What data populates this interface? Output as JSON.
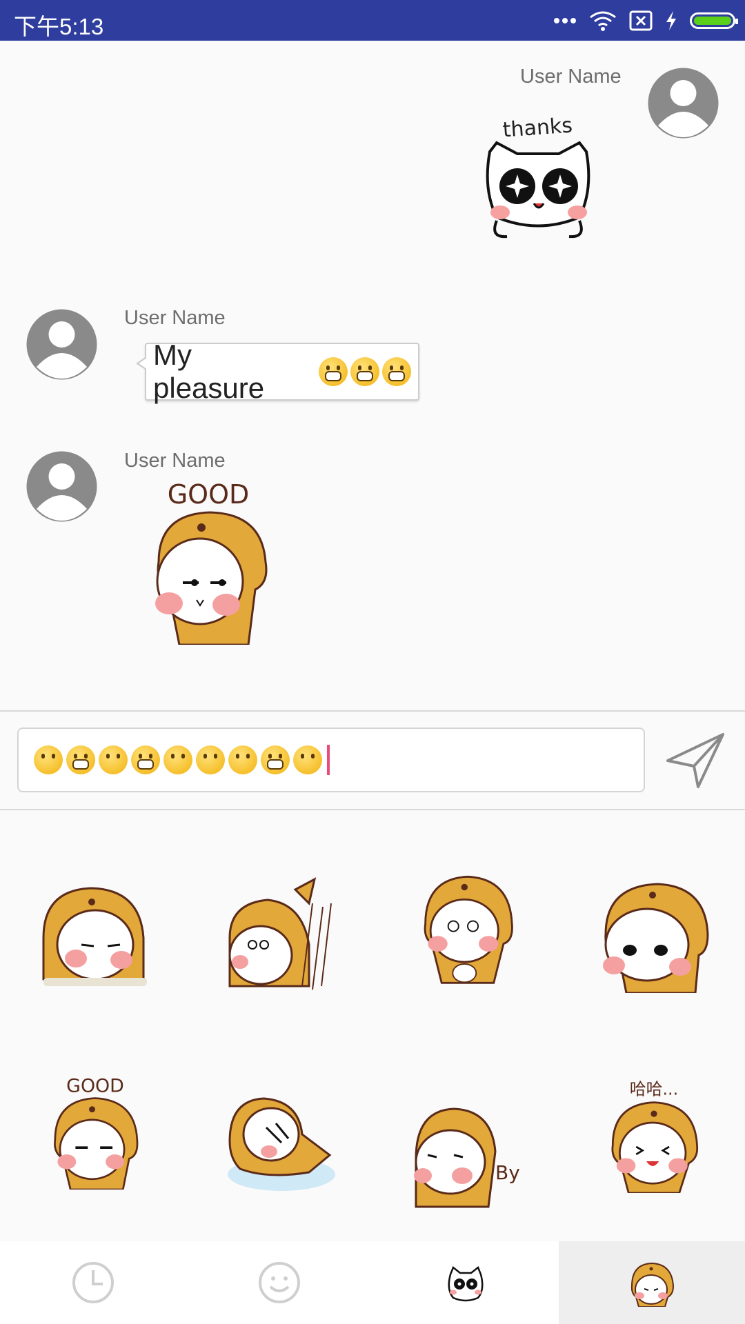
{
  "status_bar": {
    "time": "下午5:13",
    "icons": [
      "more-dots-icon",
      "wifi-icon",
      "sim-x-icon",
      "charging-bolt-icon",
      "battery-icon"
    ],
    "battery_level": 1.0,
    "battery_color": "#5ad01b",
    "background": "#2f3e9e"
  },
  "messages": [
    {
      "side": "right",
      "user_name": "User Name",
      "type": "sticker",
      "sticker": "thanks-cat-sticker",
      "sticker_text": "thanks"
    },
    {
      "side": "left",
      "user_name": "User Name",
      "type": "text",
      "text": "My pleasure",
      "emojis": [
        "grinning-face",
        "grinning-face",
        "grinning-face"
      ]
    },
    {
      "side": "left",
      "user_name": "User Name",
      "type": "sticker",
      "sticker": "good-bear-sticker",
      "sticker_text": "GOOD"
    }
  ],
  "input": {
    "emojis": [
      "smiling-blush",
      "grin",
      "smile",
      "big-smile",
      "wink",
      "flushed",
      "tongue-wink",
      "grimace",
      "kiss-closed-eyes"
    ],
    "send_icon": "send-icon"
  },
  "sticker_grid": [
    {
      "name": "bear-sticker-sleepy",
      "text": ""
    },
    {
      "name": "bear-sticker-rain",
      "text": ""
    },
    {
      "name": "bear-sticker-dizzy",
      "text": ""
    },
    {
      "name": "bear-sticker-sideeye",
      "text": ""
    },
    {
      "name": "bear-sticker-good",
      "text": "GOOD"
    },
    {
      "name": "bear-sticker-rolling",
      "text": ""
    },
    {
      "name": "bear-sticker-bye",
      "text": "By"
    },
    {
      "name": "bear-sticker-haha",
      "text": "哈哈..."
    }
  ],
  "tabs": [
    {
      "name": "recent-icon",
      "active": false
    },
    {
      "name": "emoji-icon",
      "active": false
    },
    {
      "name": "cat-sticker-pack-icon",
      "active": false
    },
    {
      "name": "bear-sticker-pack-icon",
      "active": true
    }
  ]
}
